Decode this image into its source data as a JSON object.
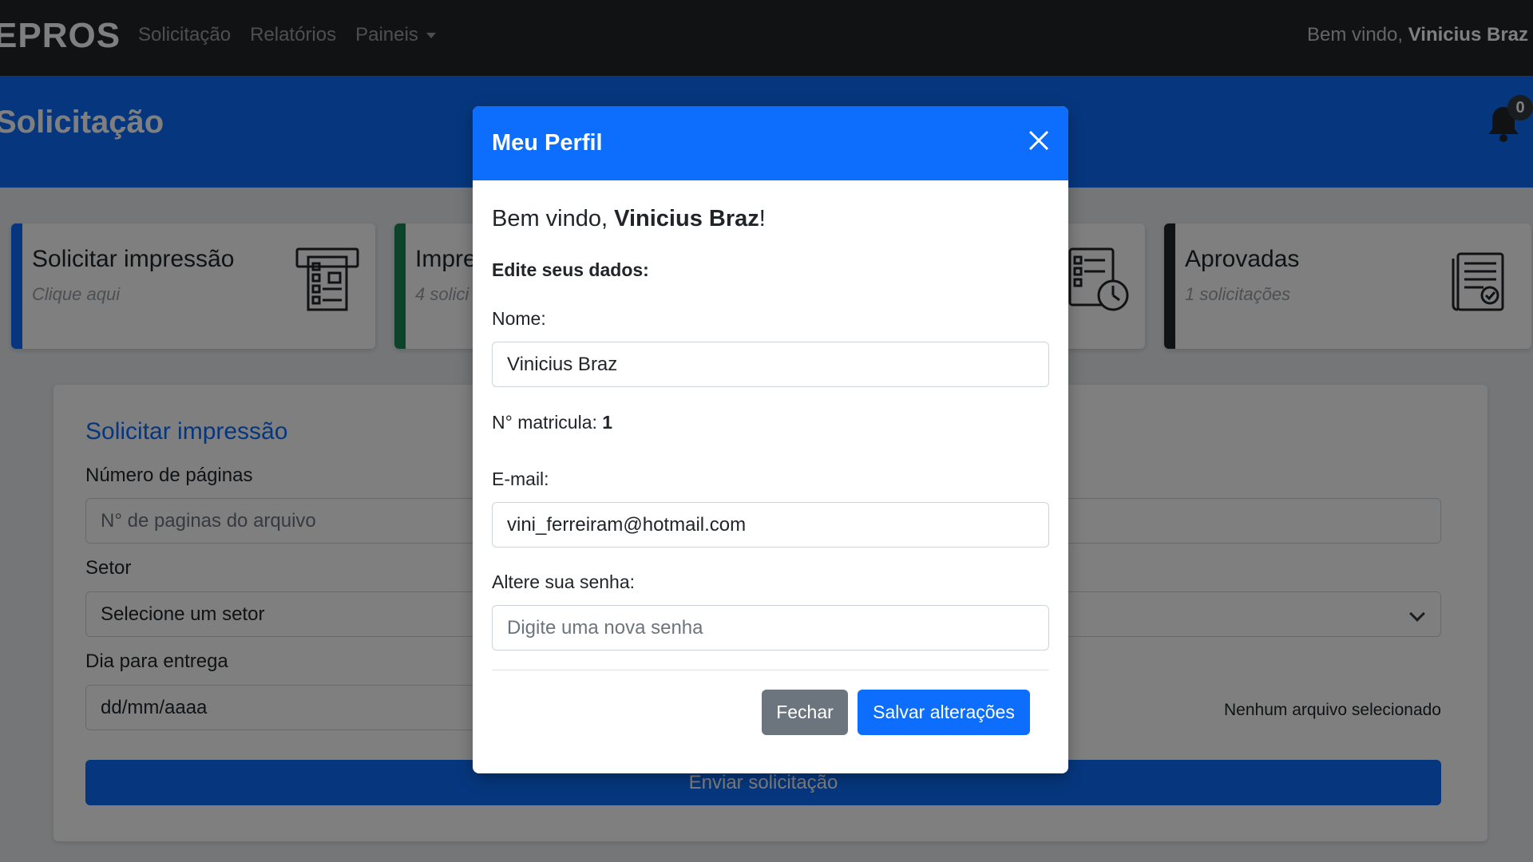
{
  "navbar": {
    "brand": "EPROS",
    "links": [
      "Solicitação",
      "Relatórios",
      "Paineis"
    ],
    "welcome_prefix": "Bem vindo,",
    "welcome_user": "Vinicius Braz"
  },
  "header": {
    "title": "Solicitação",
    "notification_count": "0",
    "icon": "bell-icon"
  },
  "cards": [
    {
      "title": "Solicitar impressão",
      "subtitle": "Clique aqui",
      "icon": "printer-form-icon",
      "accent": "#0d6efd"
    },
    {
      "title": "Impre",
      "subtitle": "4 solici",
      "icon": "",
      "accent": "#198754"
    },
    {
      "title": "",
      "subtitle": "",
      "icon": "document-clock-icon",
      "accent": "#ffc107"
    },
    {
      "title": "Aprovadas",
      "subtitle": "1 solicitações",
      "icon": "document-check-icon",
      "accent": "#212529"
    }
  ],
  "form": {
    "title": "Solicitar impressão",
    "pages_label": "Número de páginas",
    "pages_placeholder": "N° de paginas do arquivo",
    "sector_label": "Setor",
    "sector_value": "Selecione um setor",
    "date_label": "Dia para entrega",
    "date_placeholder": "dd/mm/aaaa",
    "file_status": "Nenhum arquivo selecionado",
    "submit_label": "Enviar solicitação"
  },
  "modal": {
    "title": "Meu Perfil",
    "greeting_prefix": "Bem vindo,",
    "greeting_user": "Vinicius Braz",
    "greeting_suffix": "!",
    "edit_label": "Edite seus dados:",
    "name_label": "Nome:",
    "name_value": "Vinicius Braz",
    "matricula_label": "N° matricula:",
    "matricula_value": "1",
    "email_label": "E-mail:",
    "email_value": "vini_ferreiram@hotmail.com",
    "password_label": "Altere sua senha:",
    "password_placeholder": "Digite uma nova senha",
    "close_label": "Fechar",
    "save_label": "Salvar alterações"
  },
  "colors": {
    "primary": "#0d6efd",
    "dark": "#212529",
    "secondary": "#6c757d",
    "success": "#198754"
  }
}
